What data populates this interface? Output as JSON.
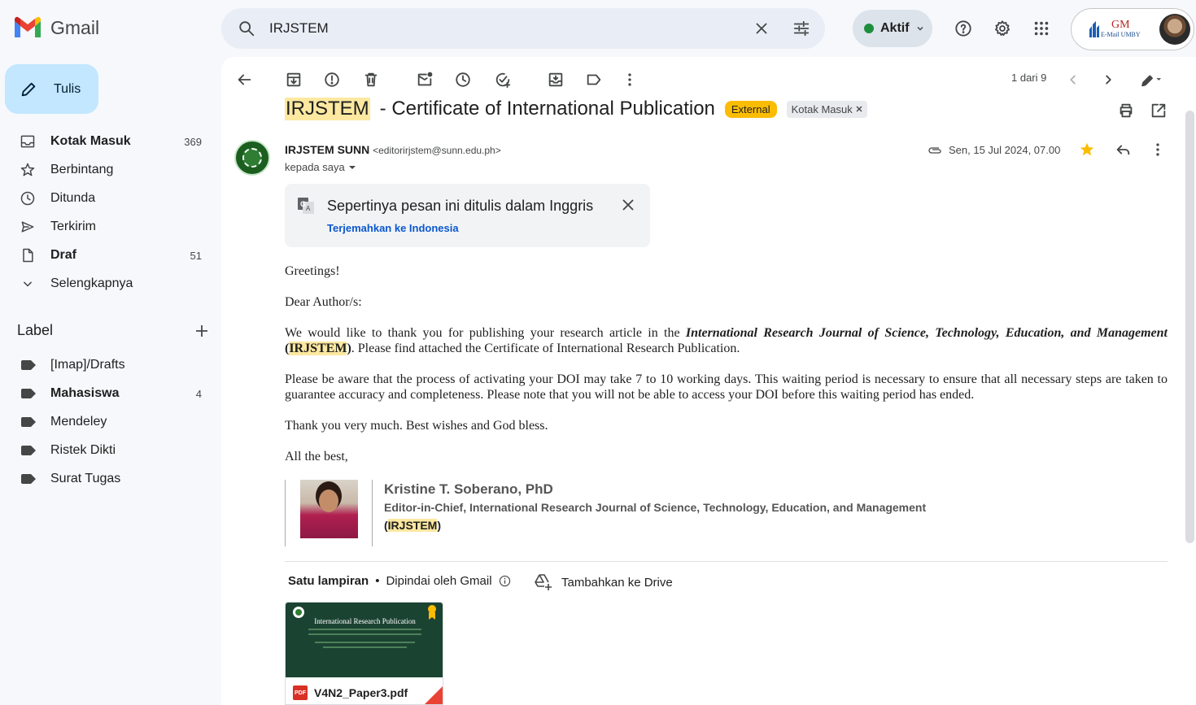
{
  "app": {
    "name": "Gmail"
  },
  "search": {
    "query": "IRJSTEM"
  },
  "status": {
    "label": "Aktif"
  },
  "account": {
    "org_top": "GM",
    "org_bottom": "E-Mail UMBY"
  },
  "compose": {
    "label": "Tulis"
  },
  "nav": [
    {
      "label": "Kotak Masuk",
      "count": "369",
      "icon": "inbox-icon",
      "bold": true
    },
    {
      "label": "Berbintang",
      "count": "",
      "icon": "star-icon",
      "bold": false
    },
    {
      "label": "Ditunda",
      "count": "",
      "icon": "clock-icon",
      "bold": false
    },
    {
      "label": "Terkirim",
      "count": "",
      "icon": "send-icon",
      "bold": false
    },
    {
      "label": "Draf",
      "count": "51",
      "icon": "draft-icon",
      "bold": true
    },
    {
      "label": "Selengkapnya",
      "count": "",
      "icon": "chevron-down-icon",
      "bold": false
    }
  ],
  "labels": {
    "heading": "Label",
    "items": [
      {
        "label": "[Imap]/Drafts",
        "count": ""
      },
      {
        "label": "Mahasiswa",
        "count": "4"
      },
      {
        "label": "Mendeley",
        "count": ""
      },
      {
        "label": "Ristek Dikti",
        "count": ""
      },
      {
        "label": "Surat Tugas",
        "count": ""
      }
    ]
  },
  "pager": {
    "text": "1 dari 9"
  },
  "email": {
    "subject_highlight": "IRJSTEM",
    "subject_rest": "- Certificate of International Publication",
    "badge_external": "External",
    "badge_inbox": "Kotak Masuk",
    "sender_name": "IRJSTEM SUNN",
    "sender_email": "<editorirjstem@sunn.edu.ph>",
    "recipient": "kepada saya",
    "date": "Sen, 15 Jul 2024, 07.00",
    "translate_title": "Sepertinya pesan ini ditulis dalam Inggris",
    "translate_link": "Terjemahkan ke Indonesia",
    "greeting": "Greetings!",
    "salutation": "Dear Author/s:",
    "p1_a": "We would like to thank you for publishing your research article in the",
    "p1_journal": "International Research Journal of Science, Technology, Education, and Management",
    "p1_open": "(",
    "p1_abbr": "IRJSTEM",
    "p1_close": ")",
    "p1_b": ". Please find attached the Certificate of International Research Publication.",
    "p2": "Please be aware that the process of activating your DOI may take 7 to 10 working days. This waiting period is necessary to ensure that all necessary steps are taken to guarantee accuracy and completeness. Please note that you will not be able to access your DOI before this waiting period has ended.",
    "p3": "Thank you very much. Best wishes and God bless.",
    "closing": "All the best,",
    "sig_name": "Kristine T. Soberano, PhD",
    "sig_title": "Editor-in-Chief, International Research Journal of Science, Technology, Education, and Management",
    "sig_open": "(",
    "sig_abbr": "IRJSTEM",
    "sig_close": ")"
  },
  "attachments": {
    "count_label": "Satu lampiran",
    "scanned": "Dipindai oleh Gmail",
    "add_drive": "Tambahkan ke Drive",
    "file_name": "V4N2_Paper3.pdf",
    "file_type": "PDF",
    "thumb_title": "International Research Publication"
  },
  "colors": {
    "compose_bg": "#c2e7ff",
    "badge_external": "#fbbc04",
    "highlight": "#fce8a0",
    "link": "#0b57d0",
    "status_dot": "#1e8e3e",
    "star": "#fbbc04"
  }
}
